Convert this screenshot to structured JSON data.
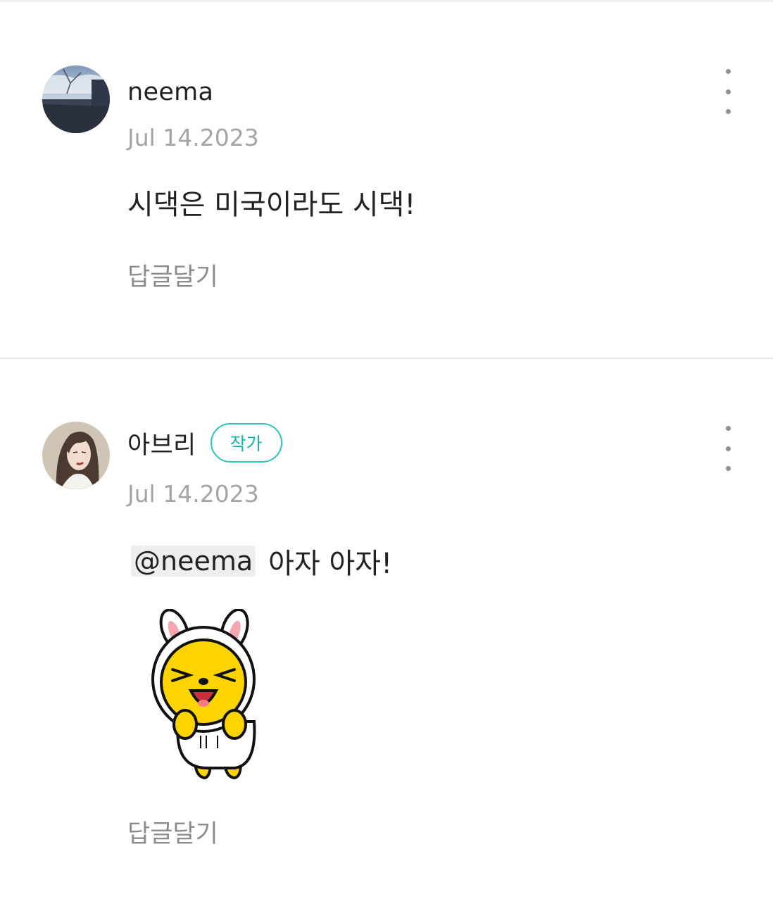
{
  "comments": [
    {
      "author": "neema",
      "date": "Jul 14.2023",
      "text": "시댁은 미국이라도 시댁!",
      "reply_label": "답글달기",
      "avatar_icon": "landscape-avatar",
      "more_icon": "more-vertical-icon"
    },
    {
      "author": "아브리",
      "badge": "작가",
      "date": "Jul 14.2023",
      "mention": "@neema",
      "text": "아자 아자!",
      "sticker": "bunny-hood-character-sticker",
      "reply_label": "답글달기",
      "avatar_icon": "woman-portrait-avatar",
      "more_icon": "more-vertical-icon"
    }
  ],
  "colors": {
    "badge": "#29c7b9",
    "date": "#a4a4a4",
    "reply": "#8c8c8c",
    "text": "#222222",
    "mention_bg": "#eeeeee"
  }
}
